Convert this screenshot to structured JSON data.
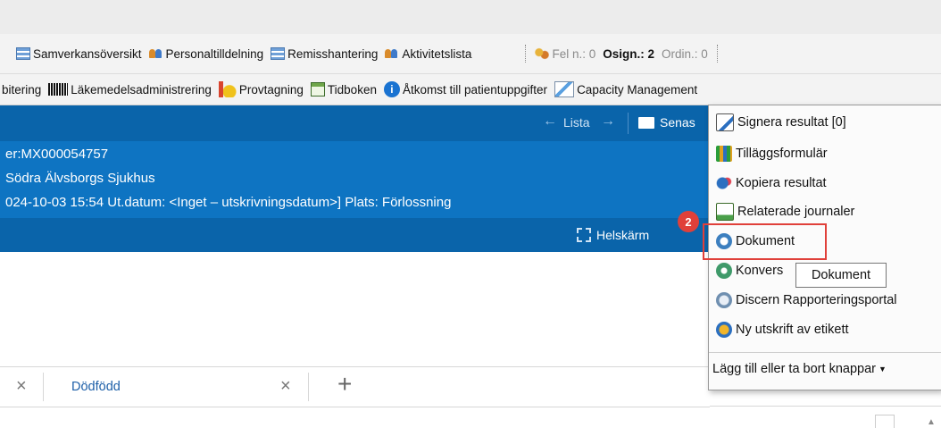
{
  "toolbar1": {
    "items": [
      "Samverkansöversikt",
      "Personaltilldelning",
      "Remisshantering",
      "Aktivitetslista"
    ],
    "status": {
      "fel": "Fel n.: 0",
      "osign": "Osign.: 2",
      "ordin": "Ordin.: 0"
    }
  },
  "toolbar2": {
    "items": [
      "bitering",
      "Läkemedelsadministrering",
      "Provtagning",
      "Tidboken",
      "Åtkomst till patientuppgifter",
      "Capacity Management"
    ]
  },
  "nav": {
    "lista": "Lista",
    "senaste": "Senas"
  },
  "patient": {
    "line1": "er:MX000054757",
    "line2": "Södra Älvsborgs Sjukhus",
    "line3": "024-10-03 15:54 Ut.datum: <Inget – utskrivningsdatum>] Plats: Förlossning"
  },
  "bar3": {
    "helskarm": "Helskärm"
  },
  "tabs": {
    "close": "×",
    "tab_label": "Dödfödd",
    "add": "+"
  },
  "menu": {
    "items": [
      "Signera resultat [0]",
      "Tilläggsformulär",
      "Kopiera resultat",
      "Relaterade journaler",
      "Dokument",
      "Konvers",
      "Discern Rapporteringsportal",
      "Ny utskrift av etikett"
    ],
    "footer": "Lägg till eller ta bort knappar"
  },
  "tooltip": "Dokument",
  "badge": "2",
  "colors": {
    "header_dark": "#0a64aa",
    "header_light": "#0e74c2",
    "highlight": "#e0403a"
  }
}
